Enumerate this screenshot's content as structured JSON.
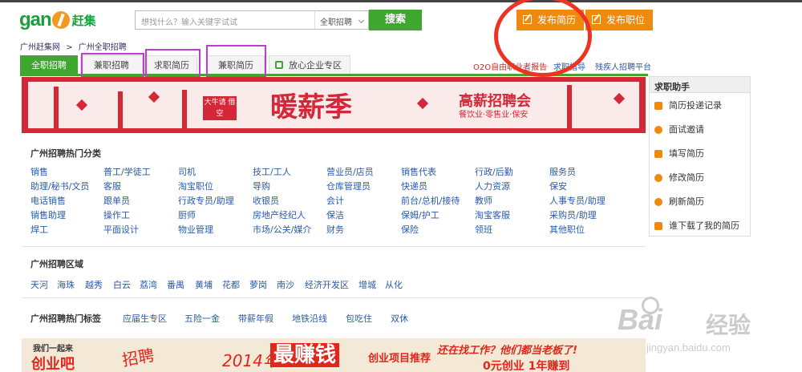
{
  "header": {
    "logo_text": "gan",
    "logo_cn": "赶集",
    "search_placeholder": "想找什么？输入关键字试试",
    "search_scope": "全职招聘",
    "search_button": "搜索",
    "post_resume": "发布简历",
    "post_job": "发布职位"
  },
  "breadcrumb": {
    "items": [
      "广州赶集网",
      ">",
      "广州全职招聘"
    ]
  },
  "tabs": [
    "全职招聘",
    "兼职招聘",
    "求职简历",
    "兼职简历",
    "放心企业专区"
  ],
  "top_links": [
    "O2O自由职业者报告",
    "求职指导",
    "残疾人招聘平台"
  ],
  "banner": {
    "sticker": "大牛请 借空",
    "title": "暖薪季",
    "fair": "高薪招聘会",
    "sub": "餐饮业·零售业·保安"
  },
  "categories": {
    "title": "广州招聘热门分类",
    "rows": [
      [
        "销售",
        "普工/学徒工",
        "司机",
        "技工/工人",
        "营业员/店员",
        "销售代表",
        "行政/后勤",
        "服务员"
      ],
      [
        "助理/秘书/文员",
        "客服",
        "淘宝职位",
        "导购",
        "仓库管理员",
        "快递员",
        "人力资源",
        "保安"
      ],
      [
        "电话销售",
        "跟单员",
        "行政专员/助理",
        "收银员",
        "会计",
        "前台/总机/接待",
        "教师",
        "人事专员/助理"
      ],
      [
        "销售助理",
        "操作工",
        "厨师",
        "房地产经纪人",
        "保洁",
        "保姆/护工",
        "淘宝客服",
        "采购员/助理"
      ],
      [
        "焊工",
        "平面设计",
        "物业管理",
        "市场/公关/媒介",
        "财务",
        "保险",
        "领班",
        "其他职位"
      ]
    ]
  },
  "regions": {
    "title": "广州招聘区域",
    "items": [
      "天河",
      "海珠",
      "越秀",
      "白云",
      "荔湾",
      "番禺",
      "黄埔",
      "花都",
      "萝岗",
      "南沙",
      "经济开发区",
      "增城",
      "从化"
    ]
  },
  "tags": {
    "title": "广州招聘热门标签",
    "items": [
      "应届生专区",
      "五险一金",
      "带薪年假",
      "地铁沿线",
      "包吃住",
      "双休"
    ]
  },
  "sidebar": {
    "title": "求职助手",
    "items": [
      "简历投递记录",
      "面试邀请",
      "填写简历",
      "修改简历",
      "刷新简历",
      "谁下载了我的简历"
    ]
  },
  "ad": {
    "t1": "我们一起来",
    "t2": "创业吧",
    "t3": "招聘",
    "t4": "2014年",
    "t5": "最赚钱",
    "t6": "创业项目推荐",
    "t7": "还在找工作？他们都当老板了!",
    "t8": "0元创业 1年赚到"
  },
  "watermark": {
    "brand": "Bai",
    "cn": "经验",
    "url": "jingyan.baidu.com"
  },
  "colors": {
    "green": "#3fa62f",
    "orange": "#f08a0e",
    "red": "#d42838",
    "link": "#2a5aa8",
    "highlight": "#c23ad6",
    "circle": "#ee3322"
  }
}
